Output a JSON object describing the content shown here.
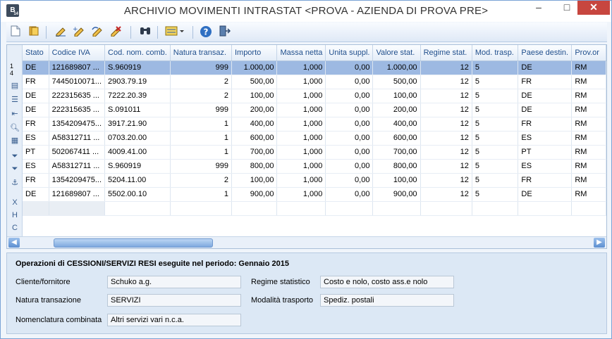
{
  "window": {
    "title": "ARCHIVIO MOVIMENTI INTRASTAT <PROVA - AZIENDA DI PROVA PRE>",
    "app_icon_letter": "B",
    "app_icon_sub": "14",
    "min_glyph": "–",
    "max_glyph": "□",
    "close_glyph": "✕"
  },
  "toolbar": {
    "icons": [
      "new-document-icon",
      "open-folder-icon",
      "edit-icon",
      "edit-add-icon",
      "undo-icon",
      "delete-icon",
      "binoculars-search-icon",
      "list-view-icon",
      "help-icon",
      "exit-door-icon"
    ]
  },
  "grid": {
    "columns": [
      "Stato",
      "Codice IVA",
      "Cod. nom. comb.",
      "Natura transaz.",
      "Importo",
      "Massa netta",
      "Unita suppl.",
      "Valore stat.",
      "Regime stat.",
      "Mod. trasp.",
      "Paese destin.",
      "Prov.or"
    ],
    "row_header_top": [
      "1",
      "4"
    ],
    "rows": [
      [
        "DE",
        "121689807 ...",
        "S.960919",
        "999",
        "1.000,00",
        "1,000",
        "0,00",
        "1.000,00",
        "12",
        "5",
        "DE",
        "RM"
      ],
      [
        "FR",
        "7445010071...",
        "2903.79.19",
        "2",
        "500,00",
        "1,000",
        "0,00",
        "500,00",
        "12",
        "5",
        "FR",
        "RM"
      ],
      [
        "DE",
        "222315635 ...",
        "7222.20.39",
        "2",
        "100,00",
        "1,000",
        "0,00",
        "100,00",
        "12",
        "5",
        "DE",
        "RM"
      ],
      [
        "DE",
        "222315635 ...",
        "S.091011",
        "999",
        "200,00",
        "1,000",
        "0,00",
        "200,00",
        "12",
        "5",
        "DE",
        "RM"
      ],
      [
        "FR",
        "1354209475...",
        "3917.21.90",
        "1",
        "400,00",
        "1,000",
        "0,00",
        "400,00",
        "12",
        "5",
        "FR",
        "RM"
      ],
      [
        "ES",
        "A58312711 ...",
        "0703.20.00",
        "1",
        "600,00",
        "1,000",
        "0,00",
        "600,00",
        "12",
        "5",
        "ES",
        "RM"
      ],
      [
        "PT",
        "502067411 ...",
        "4009.41.00",
        "1",
        "700,00",
        "1,000",
        "0,00",
        "700,00",
        "12",
        "5",
        "PT",
        "RM"
      ],
      [
        "ES",
        "A58312711 ...",
        "S.960919",
        "999",
        "800,00",
        "1,000",
        "0,00",
        "800,00",
        "12",
        "5",
        "ES",
        "RM"
      ],
      [
        "FR",
        "1354209475...",
        "5204.11.00",
        "2",
        "100,00",
        "1,000",
        "0,00",
        "100,00",
        "12",
        "5",
        "FR",
        "RM"
      ],
      [
        "DE",
        "121689807 ...",
        "5502.00.10",
        "1",
        "900,00",
        "1,000",
        "0,00",
        "900,00",
        "12",
        "5",
        "DE",
        "RM"
      ]
    ],
    "selected_row": 0
  },
  "details": {
    "heading": "Operazioni di  CESSIONI/SERVIZI RESI  eseguite nel periodo:   Gennaio 2015",
    "cliente_label": "Cliente/fornitore",
    "cliente_value": "Schuko a.g.",
    "natura_label": "Natura transazione",
    "natura_value": "SERVIZI",
    "nomenclatura_label": "Nomenclatura combinata",
    "nomenclatura_value": "Altri servizi vari n.c.a.",
    "regime_label": "Regime statistico",
    "regime_value": "Costo e nolo, costo ass.e nolo",
    "modalita_label": "Modalità trasporto",
    "modalita_value": "Spediz. postali"
  }
}
